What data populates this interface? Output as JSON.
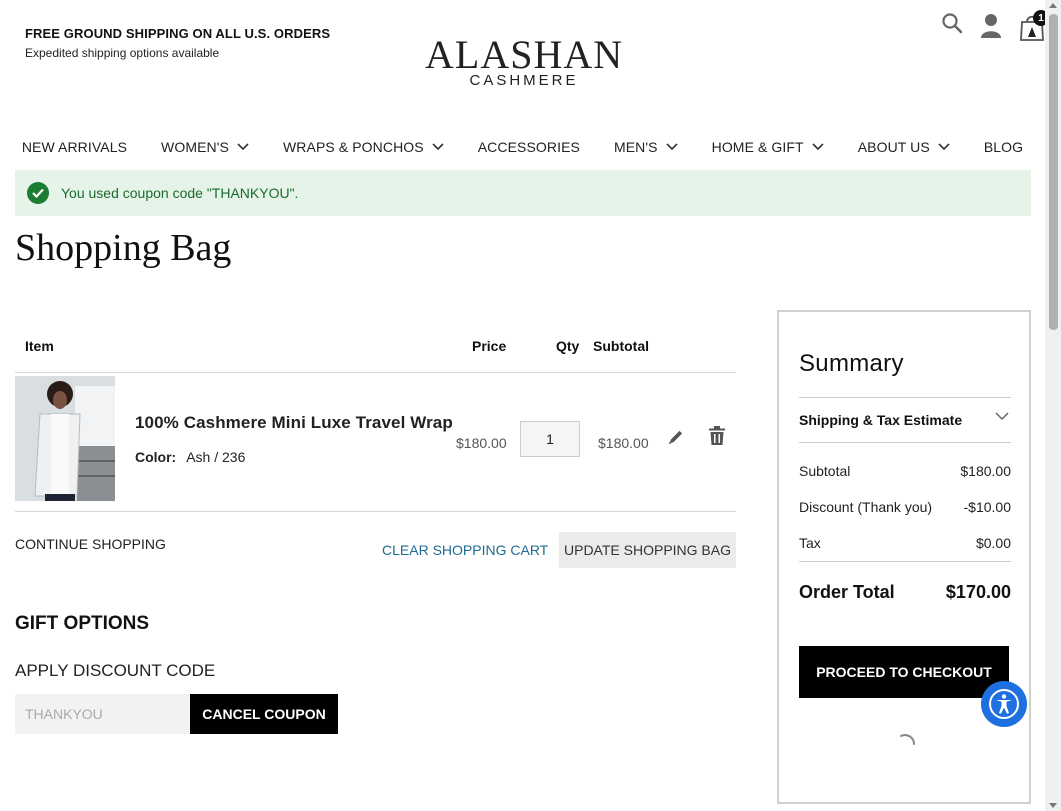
{
  "header": {
    "promo_title": "FREE GROUND SHIPPING ON ALL U.S. ORDERS",
    "promo_subtitle": "Expedited shipping options available",
    "logo_main": "ALASHAN",
    "logo_sub": "CASHMERE",
    "cart_count": "1",
    "icons": [
      "search-icon",
      "account-icon",
      "cart-icon"
    ]
  },
  "nav": {
    "items": [
      {
        "label": "NEW ARRIVALS",
        "has_dropdown": false
      },
      {
        "label": "WOMEN'S",
        "has_dropdown": true
      },
      {
        "label": "WRAPS & PONCHOS",
        "has_dropdown": true
      },
      {
        "label": "ACCESSORIES",
        "has_dropdown": false
      },
      {
        "label": "MEN'S",
        "has_dropdown": true
      },
      {
        "label": "HOME & GIFT",
        "has_dropdown": true
      },
      {
        "label": "ABOUT US",
        "has_dropdown": true
      },
      {
        "label": "BLOG",
        "has_dropdown": false
      }
    ]
  },
  "notice": {
    "message": "You used coupon code \"THANKYOU\".",
    "color": "#1b7c33"
  },
  "page_title": "Shopping Bag",
  "cart": {
    "headers": {
      "item": "Item",
      "price": "Price",
      "qty": "Qty",
      "subtotal": "Subtotal"
    },
    "items": [
      {
        "name": "100% Cashmere Mini Luxe Travel Wrap",
        "color_label": "Color:",
        "color_value": "Ash / 236",
        "price": "$180.00",
        "qty": "1",
        "subtotal": "$180.00"
      }
    ],
    "continue_label": "CONTINUE SHOPPING",
    "clear_label": "CLEAR SHOPPING CART",
    "update_label": "UPDATE SHOPPING BAG"
  },
  "gift": {
    "title": "GIFT OPTIONS",
    "discount_title": "APPLY DISCOUNT CODE",
    "coupon_value": "THANKYOU",
    "cancel_label": "CANCEL COUPON"
  },
  "summary": {
    "title": "Summary",
    "shipping_estimate": "Shipping & Tax Estimate",
    "rows": [
      {
        "label": "Subtotal",
        "value": "$180.00"
      },
      {
        "label": "Discount (Thank you)",
        "value": "-$10.00"
      },
      {
        "label": "Tax",
        "value": "$0.00"
      }
    ],
    "order_total_label": "Order Total",
    "order_total_value": "$170.00",
    "checkout_label": "PROCEED TO CHECKOUT"
  },
  "accessibility": {
    "icon": "accessibility-icon",
    "color": "#1e6fe0"
  }
}
